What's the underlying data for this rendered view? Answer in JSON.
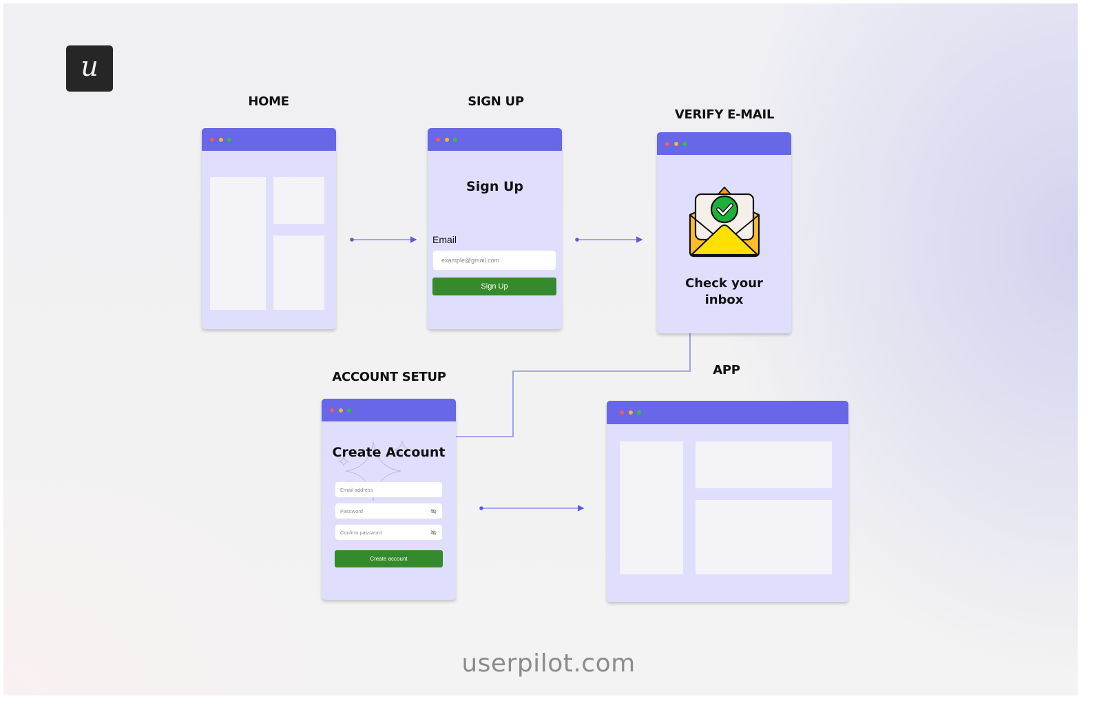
{
  "brand": {
    "logo_glyph": "u",
    "footer_text": "userpilot.com"
  },
  "colors": {
    "window_bar": "#6767e7",
    "window_body": "#dfdefd",
    "placeholder_block": "#f3f3f8",
    "connector": "#8c8cee",
    "connector_dot": "#5a5ae6",
    "button_green": "#358a2b",
    "dot_red": "#f45b5b",
    "dot_yellow": "#f7b52a",
    "dot_green": "#2fc23f"
  },
  "steps": {
    "home": {
      "label": "HOME"
    },
    "signup": {
      "label": "SIGN UP",
      "heading": "Sign Up",
      "email_label": "Email",
      "email_placeholder": "example@gmail.com",
      "button": "Sign Up"
    },
    "verify": {
      "label": "VERIFY E-MAIL",
      "icon": "envelope-check-icon",
      "message_line1": "Check your",
      "message_line2": "inbox"
    },
    "account": {
      "label": "ACCOUNT SETUP",
      "heading": "Create Account",
      "email_placeholder": "Email address",
      "password_placeholder": "Password",
      "confirm_placeholder": "Confirm password",
      "button": "Create account",
      "eye_icon": "eye-off-icon"
    },
    "app": {
      "label": "APP"
    }
  },
  "flow": [
    {
      "from": "HOME",
      "to": "SIGN UP"
    },
    {
      "from": "SIGN UP",
      "to": "VERIFY E-MAIL"
    },
    {
      "from": "VERIFY E-MAIL",
      "to": "ACCOUNT SETUP"
    },
    {
      "from": "ACCOUNT SETUP",
      "to": "APP"
    }
  ]
}
